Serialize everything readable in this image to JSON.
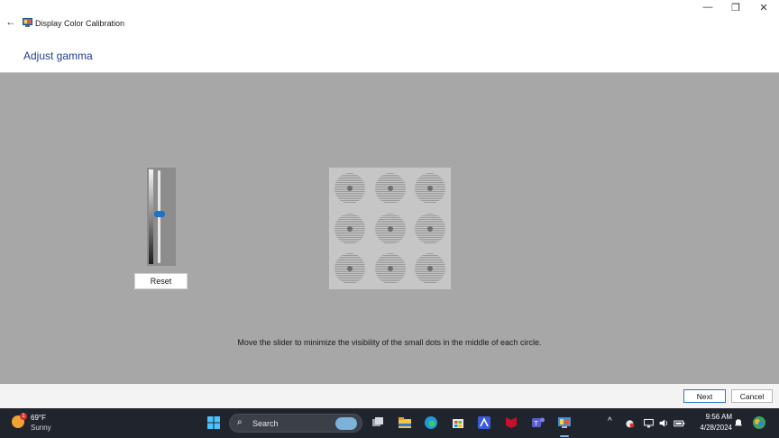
{
  "window": {
    "back_glyph": "←",
    "title": "Display Color Calibration",
    "minimize_glyph": "—",
    "restore_glyph": "❐",
    "close_glyph": "✕"
  },
  "page": {
    "heading": "Adjust gamma",
    "reset_label": "Reset",
    "gamma_slider_level_percent": 47,
    "instruction": "Move the slider to minimize the visibility of the small dots in the middle of each circle."
  },
  "footer": {
    "next_label": "Next",
    "cancel_label": "Cancel"
  },
  "taskbar": {
    "weather_temp": "69°F",
    "weather_condition": "Sunny",
    "weather_badge": "1",
    "search_label": "Search",
    "search_glyph": "⌕",
    "icons": [
      "start-icon",
      "task-view-icon",
      "file-explorer-icon",
      "edge-icon",
      "store-icon",
      "app-icon",
      "mcafee-icon",
      "teams-icon",
      "calibration-app-icon"
    ],
    "tray_chevron": "^",
    "time": "9:56 AM",
    "date": "4/28/2024"
  },
  "colors": {
    "accent": "#1d72c9",
    "stage_gray": "#a7a7a7",
    "heading_blue": "#1f3f8f",
    "taskbar_bg": "#20242c"
  }
}
